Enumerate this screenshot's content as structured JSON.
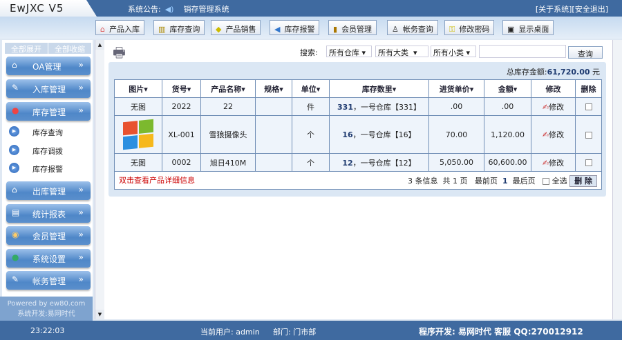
{
  "header": {
    "logo": "EwJXC V5",
    "notice_label": "系统公告:",
    "notice_text": "销存管理系统",
    "about": "[关于系统]",
    "logout": "[安全退出]"
  },
  "toolbar": [
    {
      "label": "产品入库",
      "icon": "house-icon"
    },
    {
      "label": "库存查询",
      "icon": "book-icon"
    },
    {
      "label": "产品销售",
      "icon": "tag-icon"
    },
    {
      "label": "库存报警",
      "icon": "speaker-icon"
    },
    {
      "label": "会员管理",
      "icon": "card-icon"
    },
    {
      "label": "帐务查询",
      "icon": "bottle-icon"
    },
    {
      "label": "修改密码",
      "icon": "key-icon"
    },
    {
      "label": "显示桌面",
      "icon": "desktop-icon"
    }
  ],
  "sidebar": {
    "expand_all": "全部展开",
    "collapse_all": "全部收缩",
    "menus": [
      {
        "label": "OA管理"
      },
      {
        "label": "入库管理"
      },
      {
        "label": "库存管理"
      },
      {
        "label": "出库管理"
      },
      {
        "label": "统计报表"
      },
      {
        "label": "会员管理"
      },
      {
        "label": "系统设置"
      },
      {
        "label": "帐务管理"
      }
    ],
    "submenu": [
      "库存查询",
      "库存调拨",
      "库存报警"
    ],
    "powered": "Powered by ew80.com",
    "dev": "系统开发:易网时代"
  },
  "search": {
    "label": "搜索:",
    "warehouse": "所有仓库",
    "category": "所有大类",
    "subcategory": "所有小类",
    "keyword": "",
    "button": "查询"
  },
  "total": {
    "label": "总库存金额:",
    "value": "61,720.00",
    "unit": "元"
  },
  "table": {
    "headers": [
      "图片",
      "货号",
      "产品名称",
      "规格",
      "单位",
      "库存数里",
      "进货单价",
      "金额",
      "修改",
      "删除"
    ],
    "rows": [
      {
        "image": "无图",
        "sku": "2022",
        "name": "22",
        "spec": "",
        "unit": "件",
        "qty": "331",
        "stock": "，一号仓库【331】",
        "price": ".00",
        "amount": ".00",
        "edit": "修改"
      },
      {
        "image": "",
        "sku": "XL-001",
        "name": "雪狼摄像头",
        "spec": "",
        "unit": "个",
        "qty": "16",
        "stock": "，一号仓库【16】",
        "price": "70.00",
        "amount": "1,120.00",
        "edit": "修改"
      },
      {
        "image": "无图",
        "sku": "0002",
        "name": "旭日410M",
        "spec": "",
        "unit": "个",
        "qty": "12",
        "stock": "，一号仓库【12】",
        "price": "5,050.00",
        "amount": "60,600.00",
        "edit": "修改"
      }
    ]
  },
  "table_footer": {
    "hint": "双击查看产品详细信息",
    "count": "3 条信息",
    "pages": "共 1 页",
    "first": "最前页",
    "page": "1",
    "last": "最后页",
    "select_all": "全选",
    "delete": "删 除"
  },
  "footer": {
    "time": "23:22:03",
    "user": "当前用户: admin",
    "dept": "部门: 门市部",
    "dev": "程序开发: 易网时代 客服 QQ:270012912"
  }
}
